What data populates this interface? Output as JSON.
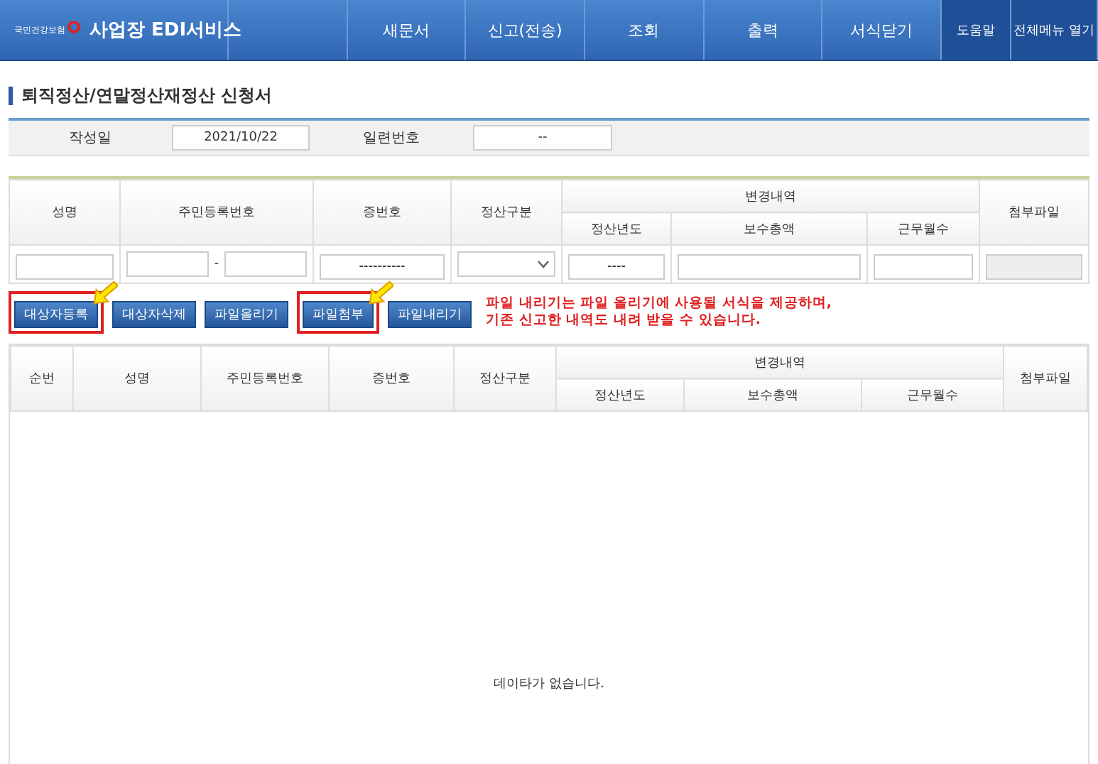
{
  "header": {
    "logo_text": "국민건강보험",
    "service_name": "사업장 EDI서비스",
    "menu": [
      {
        "label": "새문서",
        "kind": "main"
      },
      {
        "label": "신고(전송)",
        "kind": "main"
      },
      {
        "label": "조회",
        "kind": "main"
      },
      {
        "label": "출력",
        "kind": "main"
      },
      {
        "label": "서식닫기",
        "kind": "main"
      },
      {
        "label": "도움말",
        "kind": "utility"
      },
      {
        "label": "전체메뉴 열기",
        "kind": "utility"
      }
    ]
  },
  "title": "퇴직정산/연말정산재정산 신청서",
  "info": [
    {
      "label": "작성일",
      "value": "2021/10/22"
    },
    {
      "label": "일련번호",
      "value": "--"
    }
  ],
  "form_table": {
    "columns": [
      "성명",
      "주민등록번호",
      "증번호",
      "정산구분"
    ],
    "group": "변경내역",
    "group_columns": [
      "정산년도",
      "보수총액",
      "근무월수"
    ],
    "last_column": "첨부파일",
    "inputs": [
      {
        "kind": "text",
        "disabled": false
      },
      {
        "kind": "split",
        "disabled": false,
        "separator": "-"
      },
      {
        "kind": "text",
        "disabled": false,
        "value": "----------"
      },
      {
        "kind": "select",
        "disabled": false
      },
      {
        "kind": "text",
        "disabled": false,
        "value": "----"
      },
      {
        "kind": "text",
        "disabled": false
      },
      {
        "kind": "text",
        "disabled": false
      },
      {
        "kind": "text",
        "disabled": true
      }
    ]
  },
  "buttons": [
    {
      "label": "대상자등록",
      "highlighted": true
    },
    {
      "label": "대상자삭제",
      "highlighted": false
    },
    {
      "label": "파일올리기",
      "highlighted": false
    },
    {
      "label": "파일첨부",
      "highlighted": true
    },
    {
      "label": "파일내리기",
      "highlighted": false
    }
  ],
  "notice": [
    "파일 내리기는 파일 올리기에 사용될 서식을 제공하며,",
    "기존 신고한 내역도 내려 받을 수 있습니다."
  ],
  "results_table": {
    "columns": [
      "순번",
      "성명",
      "주민등록번호",
      "증번호",
      "정산구분"
    ],
    "group": "변경내역",
    "group_columns": [
      "정산년도",
      "보수총액",
      "근무월수"
    ],
    "last_column": "첨부파일",
    "empty_message": "데이타가 없습니다."
  }
}
